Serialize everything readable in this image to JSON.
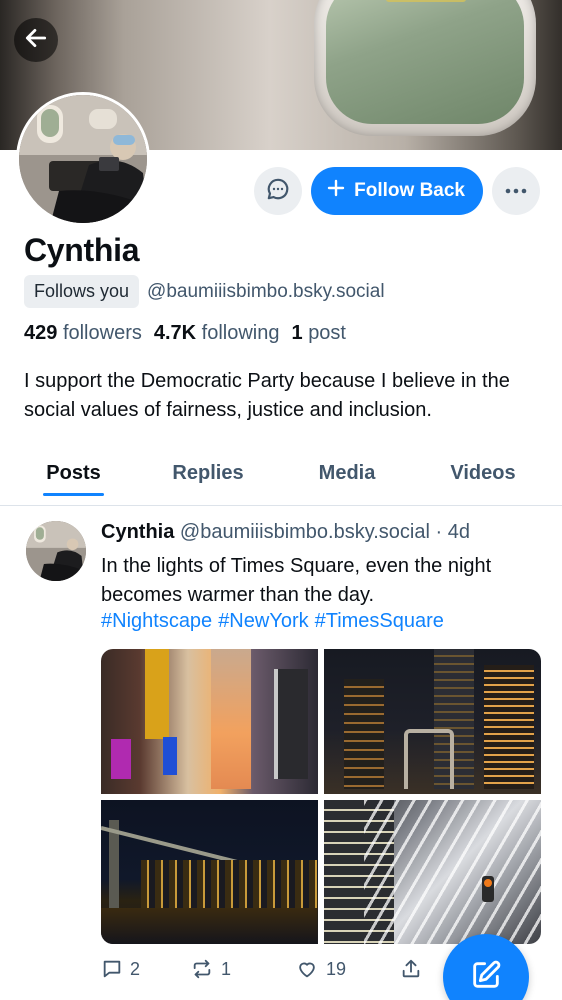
{
  "profile": {
    "display_name": "Cynthia",
    "follows_you": "Follows you",
    "handle": "@baumiiisbimbo.bsky.social",
    "stats": {
      "followers_count": "429",
      "followers_label": "followers",
      "following_count": "4.7K",
      "following_label": "following",
      "posts_count": "1",
      "posts_label": "post"
    },
    "bio": "I support the Democratic Party because I believe in the social values of fairness, justice and inclusion."
  },
  "actions": {
    "follow_back_label": "Follow Back",
    "message_icon": "chat-bubble-icon",
    "more_icon": "ellipsis-icon"
  },
  "tabs": [
    {
      "label": "Posts",
      "active": true
    },
    {
      "label": "Replies",
      "active": false
    },
    {
      "label": "Media",
      "active": false
    },
    {
      "label": "Videos",
      "active": false
    }
  ],
  "post": {
    "author_name": "Cynthia",
    "author_handle": "@baumiiisbimbo.bsky.social",
    "separator": "·",
    "time": "4d",
    "text": "In the lights of Times Square, even the night becomes warmer than the day.",
    "hashtags": [
      "#Nightscape",
      "#NewYork",
      "#TimesSquare"
    ],
    "images": [
      "times-square-night",
      "brooklyn-bridge-skyline",
      "brooklyn-bridge-waterfront",
      "oculus-structure"
    ],
    "reply_count": "2",
    "repost_count": "1",
    "like_count": "19"
  },
  "colors": {
    "accent": "#1083fe",
    "muted_text": "#42576c",
    "button_gray": "#ebeef1"
  }
}
